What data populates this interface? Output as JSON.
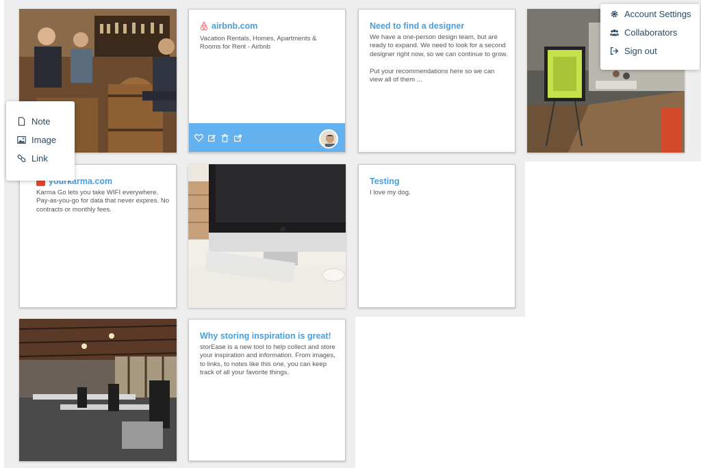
{
  "cards": {
    "airbnb": {
      "title": "airbnb.com",
      "description": "Vacation Rentals, Homes, Apartments & Rooms for Rent - Airbnb"
    },
    "designer": {
      "title": "Need to find a designer",
      "body": "We have a one-person design team, but are ready to expand. We need to look for a second designer right now, so we can continue to grow.\n\nPut your recommendations here so we can view all of them ..."
    },
    "karma": {
      "title": "yourkarma.com",
      "description": "Karma Go lets you take WIFI everywhere. Pay-as-you-go for data that never expires. No contracts or monthly fees."
    },
    "testing": {
      "title": "Testing",
      "body": "I love my dog."
    },
    "storease": {
      "title": "Why storing inspiration is great!",
      "body": "storEase is a new tool to help collect and store your inspiration and information. From images, to links, to notes like this one, you can keep track of all your favorite things."
    }
  },
  "add_menu": {
    "items": [
      {
        "label": "Note",
        "icon": "document-icon"
      },
      {
        "label": "Image",
        "icon": "image-icon"
      },
      {
        "label": "Link",
        "icon": "link-icon"
      }
    ]
  },
  "account_menu": {
    "items": [
      {
        "label": "Account Settings",
        "icon": "gear-icon"
      },
      {
        "label": "Collaborators",
        "icon": "users-icon"
      },
      {
        "label": "Sign out",
        "icon": "sign-out-icon"
      }
    ]
  },
  "colors": {
    "accent": "#4a9ed8",
    "action_bar": "#64b1f0",
    "menu_text": "#2a4a64"
  }
}
